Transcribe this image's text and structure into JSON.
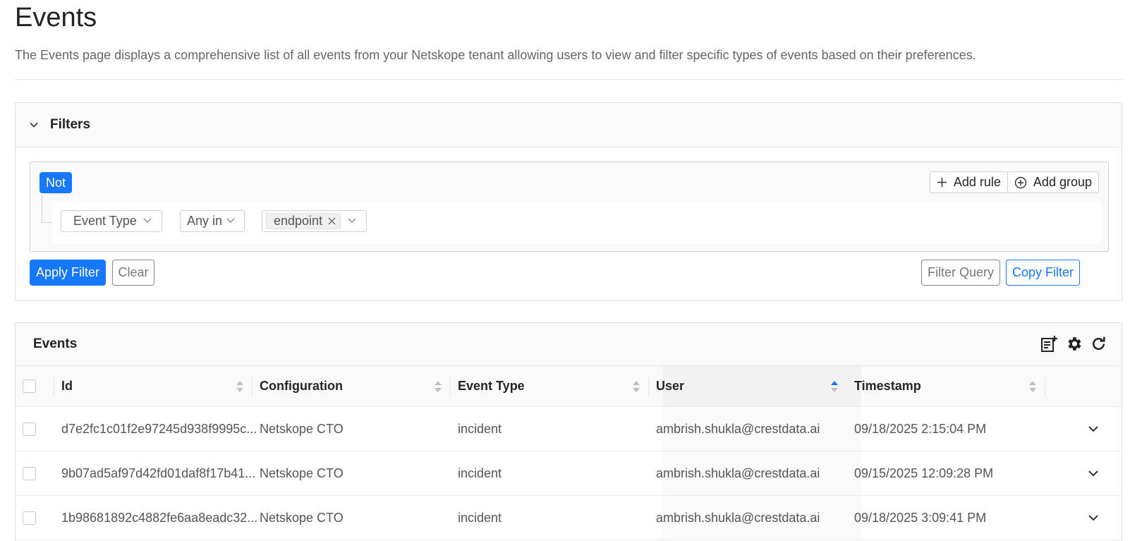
{
  "page": {
    "title": "Events",
    "description": "The Events page displays a comprehensive list of all events from your Netskope tenant allowing users to view and filter specific types of events based on their preferences."
  },
  "filters": {
    "title": "Filters",
    "not_label": "Not",
    "add_rule_label": "Add rule",
    "add_group_label": "Add group",
    "rule": {
      "field": "Event Type",
      "operator": "Any in",
      "value_tag": "endpoint"
    },
    "apply_label": "Apply Filter",
    "clear_label": "Clear",
    "filter_query_label": "Filter Query",
    "copy_filter_label": "Copy Filter"
  },
  "events": {
    "title": "Events",
    "toolbar_icons": [
      "add-note-icon",
      "gear-icon",
      "refresh-icon"
    ],
    "columns": [
      "Id",
      "Configuration",
      "Event Type",
      "User",
      "Timestamp"
    ],
    "sorted_column": "User",
    "sort_direction": "ascending",
    "rows": [
      {
        "id": "d7e2fc1c01f2e97245d938f9995c...",
        "configuration": "Netskope CTO",
        "event_type": "incident",
        "user": "ambrish.shukla@crestdata.ai",
        "timestamp": "09/18/2025 2:15:04 PM"
      },
      {
        "id": "9b07ad5af97d42fd01daf8f17b41...",
        "configuration": "Netskope CTO",
        "event_type": "incident",
        "user": "ambrish.shukla@crestdata.ai",
        "timestamp": "09/15/2025 12:09:28 PM"
      },
      {
        "id": "1b98681892c4882fe6aa8eadc32...",
        "configuration": "Netskope CTO",
        "event_type": "incident",
        "user": "ambrish.shukla@crestdata.ai",
        "timestamp": "09/18/2025 3:09:41 PM"
      }
    ]
  },
  "colors": {
    "primary": "#1677ff",
    "header_bg": "#fafafa",
    "border": "#e0e0e0"
  }
}
